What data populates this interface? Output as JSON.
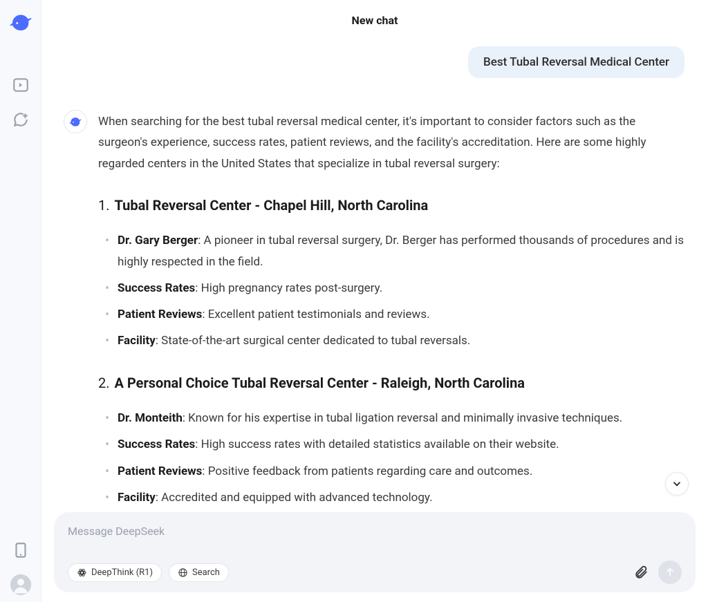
{
  "header": {
    "title": "New chat"
  },
  "sidebar": {
    "logo": "whale-icon",
    "top_items": [
      "collapse-sidebar-icon",
      "new-chat-icon"
    ],
    "bottom_items": [
      "mobile-icon",
      "profile-avatar"
    ]
  },
  "user_message": "Best Tubal Reversal Medical Center",
  "assistant": {
    "intro": "When searching for the best tubal reversal medical center, it's important to consider factors such as the surgeon's experience, success rates, patient reviews, and the facility's accreditation. Here are some highly regarded centers in the United States that specialize in tubal reversal surgery:",
    "sections": [
      {
        "num": "1.",
        "title": "Tubal Reversal Center - Chapel Hill, North Carolina",
        "items": [
          {
            "label": "Dr. Gary Berger",
            "text": ": A pioneer in tubal reversal surgery, Dr. Berger has performed thousands of procedures and is highly respected in the field."
          },
          {
            "label": "Success Rates",
            "text": ": High pregnancy rates post-surgery."
          },
          {
            "label": "Patient Reviews",
            "text": ": Excellent patient testimonials and reviews."
          },
          {
            "label": "Facility",
            "text": ": State-of-the-art surgical center dedicated to tubal reversals."
          }
        ]
      },
      {
        "num": "2.",
        "title": "A Personal Choice Tubal Reversal Center - Raleigh, North Carolina",
        "items": [
          {
            "label": "Dr. Monteith",
            "text": ": Known for his expertise in tubal ligation reversal and minimally invasive techniques."
          },
          {
            "label": "Success Rates",
            "text": ": High success rates with detailed statistics available on their website."
          },
          {
            "label": "Patient Reviews",
            "text": ": Positive feedback from patients regarding care and outcomes."
          },
          {
            "label": "Facility",
            "text": ": Accredited and equipped with advanced technology."
          }
        ]
      }
    ]
  },
  "input": {
    "placeholder": "Message DeepSeek",
    "chips": {
      "deepthink": "DeepThink (R1)",
      "search": "Search"
    }
  }
}
